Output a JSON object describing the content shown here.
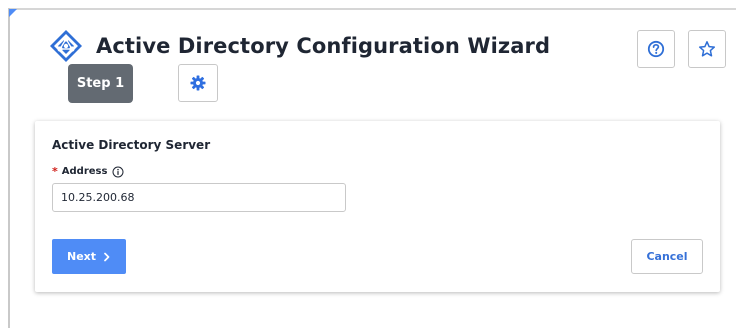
{
  "header": {
    "title": "Active Directory Configuration Wizard",
    "logo_icon": "azure-ad-diamond-icon",
    "help_icon": "question-circle-icon",
    "favorite_icon": "star-outline-icon"
  },
  "steps": {
    "current_label": "Step 1",
    "settings_icon": "gear-icon"
  },
  "form": {
    "section_title": "Active Directory Server",
    "address": {
      "required_mark": "*",
      "label": "Address",
      "value": "10.25.200.68",
      "info_icon": "info-circle-icon"
    }
  },
  "actions": {
    "next_label": "Next",
    "next_icon": "chevron-right-icon",
    "cancel_label": "Cancel"
  },
  "colors": {
    "primary": "#4f8cf6",
    "link_blue": "#3671d8",
    "step_badge": "#636a72",
    "required": "#d0201b",
    "gear": "#2f6fe0"
  }
}
